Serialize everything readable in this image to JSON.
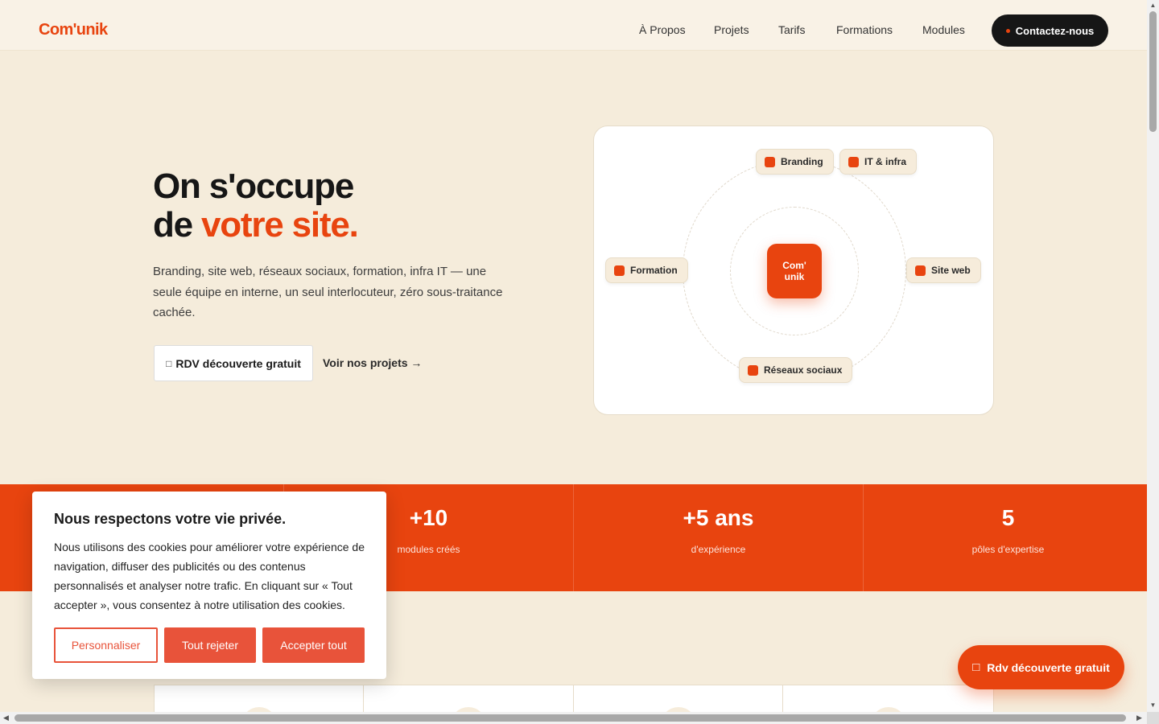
{
  "header": {
    "logo": "Com'unik",
    "nav": [
      "À Propos",
      "Projets",
      "Tarifs",
      "Formations",
      "Modules"
    ],
    "cta_label": "Contactez-nous"
  },
  "hero": {
    "title_line1": "On s'occupe",
    "title_line2_plain": "de",
    "title_line2_accent": "votre site.",
    "lead": "Branding, site web, réseaux sociaux, formation, infra IT — une seule équipe en interne, un seul interlocuteur, zéro sous-traitance cachée.",
    "primary_button": "RDV découverte gratuit",
    "primary_button_icon": "calendar-icon",
    "secondary_link": "Voir nos projets →"
  },
  "diagram": {
    "center_line1": "Com'",
    "center_line2": "unik",
    "chips": [
      "Branding",
      "IT & infra",
      "Formation",
      "Site web",
      "Réseaux sociaux"
    ]
  },
  "stats": [
    {
      "value": "+10",
      "label": "modules créés"
    },
    {
      "value": "+5 ans",
      "label": "d'expérience"
    },
    {
      "value": "5",
      "label": "pôles d'expertise"
    }
  ],
  "cookie": {
    "title": "Nous respectons votre vie privée.",
    "text": "Nous utilisons des cookies pour améliorer votre expérience de navigation, diffuser des publicités ou des contenus personnalisés et analyser notre trafic. En cliquant sur « Tout accepter », vous consentez à notre utilisation des cookies.",
    "customize": "Personnaliser",
    "reject": "Tout rejeter",
    "accept": "Accepter tout"
  },
  "floating_button": {
    "label": "Rdv découverte gratuit",
    "icon": "calendar-icon"
  },
  "colors": {
    "accent": "#e8440f",
    "background": "#f5ecdb",
    "dark": "#161616",
    "cookie_button": "#e8533a"
  }
}
